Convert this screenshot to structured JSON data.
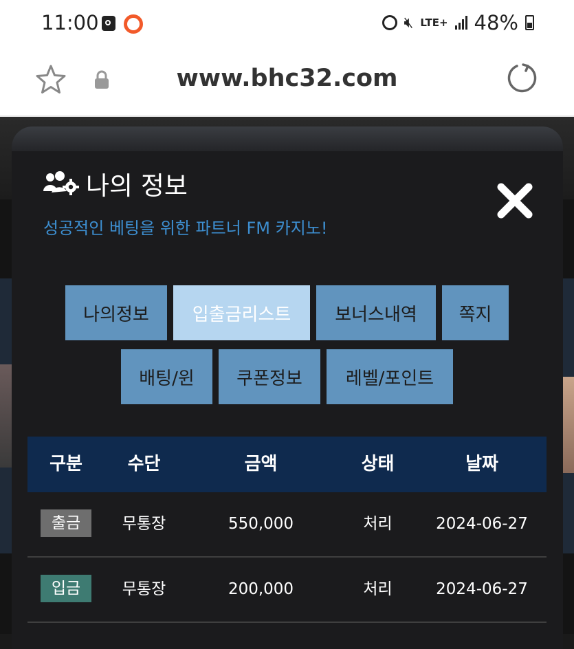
{
  "status_bar": {
    "time": "11:00",
    "network": "LTE+",
    "battery": "48%"
  },
  "browser": {
    "url": "www.bhc32.com"
  },
  "modal": {
    "title": "나의 정보",
    "subtitle": "성공적인 베팅을 위한 파트너 FM 카지노!",
    "close_label": "✕",
    "tabs": [
      {
        "label": "나의정보",
        "active": false
      },
      {
        "label": "입출금리스트",
        "active": true
      },
      {
        "label": "보너스내역",
        "active": false
      },
      {
        "label": "쪽지",
        "active": false
      },
      {
        "label": "배팅/윈",
        "active": false
      },
      {
        "label": "쿠폰정보",
        "active": false
      },
      {
        "label": "레벨/포인트",
        "active": false
      }
    ],
    "table": {
      "headers": [
        "구분",
        "수단",
        "금액",
        "상태",
        "날짜"
      ],
      "rows": [
        {
          "type": "출금",
          "method": "무통장",
          "amount": "550,000",
          "status": "처리",
          "date": "2024-06-27"
        },
        {
          "type": "입금",
          "method": "무통장",
          "amount": "200,000",
          "status": "처리",
          "date": "2024-06-27"
        }
      ]
    }
  },
  "colors": {
    "tab": "#6194be",
    "tab_active": "#b6d6f0",
    "table_header": "#0f2a4e",
    "subtitle": "#3d8fd1",
    "badge_withdraw": "#6e6e6e",
    "badge_deposit": "#3e7b72"
  }
}
